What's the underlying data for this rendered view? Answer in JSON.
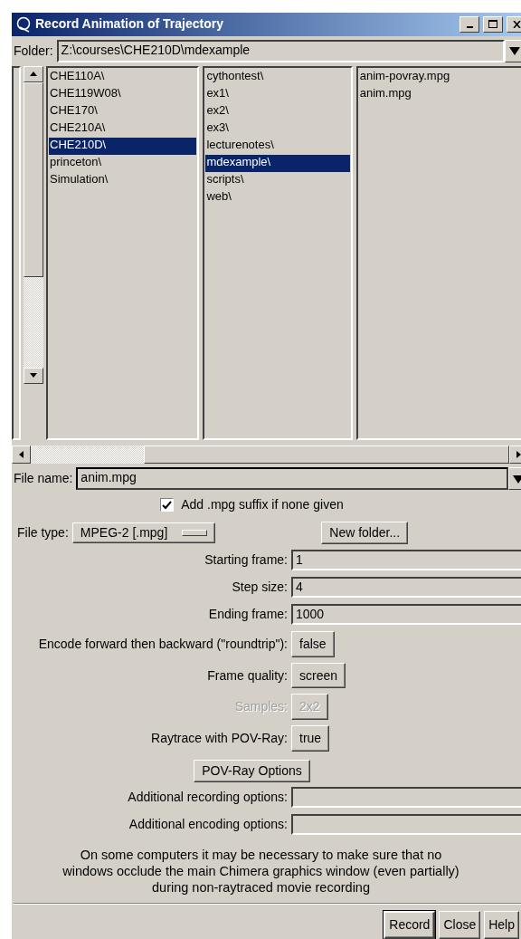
{
  "window": {
    "title": "Record Animation of Trajectory"
  },
  "folder": {
    "label": "Folder:",
    "value": "Z:\\courses\\CHE210D\\mdexample"
  },
  "columns": [
    {
      "items": [
        {
          "label": "CHE110A\\",
          "selected": false
        },
        {
          "label": "CHE119W08\\",
          "selected": false
        },
        {
          "label": "CHE170\\",
          "selected": false
        },
        {
          "label": "CHE210A\\",
          "selected": false
        },
        {
          "label": "CHE210D\\",
          "selected": true
        },
        {
          "label": "princeton\\",
          "selected": false
        },
        {
          "label": "Simulation\\",
          "selected": false
        }
      ]
    },
    {
      "items": [
        {
          "label": "cythontest\\",
          "selected": false
        },
        {
          "label": "ex1\\",
          "selected": false
        },
        {
          "label": "ex2\\",
          "selected": false
        },
        {
          "label": "ex3\\",
          "selected": false
        },
        {
          "label": "lecturenotes\\",
          "selected": false
        },
        {
          "label": "mdexample\\",
          "selected": true
        },
        {
          "label": "scripts\\",
          "selected": false
        },
        {
          "label": "web\\",
          "selected": false
        }
      ]
    },
    {
      "items": [
        {
          "label": "anim-povray.mpg",
          "selected": false
        },
        {
          "label": "anim.mpg",
          "selected": false
        }
      ]
    }
  ],
  "file_name": {
    "label": "File name:",
    "value": "anim.mpg"
  },
  "suffix_checkbox": {
    "label": "Add .mpg suffix if none given",
    "checked": true
  },
  "file_type": {
    "label": "File type:",
    "value": "MPEG-2 [.mpg]"
  },
  "new_folder_button": "New folder...",
  "options": [
    {
      "kind": "field",
      "label": "Starting frame:",
      "value": "1",
      "disabled": false
    },
    {
      "kind": "field",
      "label": "Step size:",
      "value": "4",
      "disabled": false
    },
    {
      "kind": "field",
      "label": "Ending frame:",
      "value": "1000",
      "disabled": false
    },
    {
      "kind": "toggle",
      "label": "Encode forward then backward (\"roundtrip\"):",
      "value": "false",
      "disabled": false
    },
    {
      "kind": "toggle",
      "label": "Frame quality:",
      "value": "screen",
      "disabled": false
    },
    {
      "kind": "toggle",
      "label": "Samples:",
      "value": "2x2",
      "disabled": true
    },
    {
      "kind": "toggle",
      "label": "Raytrace with POV-Ray:",
      "value": "true",
      "disabled": false
    },
    {
      "kind": "action",
      "value": "POV-Ray Options",
      "disabled": false
    },
    {
      "kind": "field",
      "label": "Additional recording options:",
      "disabled": false
    },
    {
      "kind": "field",
      "label": "Additional encoding options:",
      "disabled": false
    }
  ],
  "note": "On some computers it may be necessary to make sure that no windows occlude the main Chimera graphics window (even partially) during non-raytraced movie recording",
  "buttons": [
    {
      "label": "Record",
      "default": true
    },
    {
      "label": "Close",
      "default": false
    },
    {
      "label": "Help",
      "default": false
    }
  ]
}
